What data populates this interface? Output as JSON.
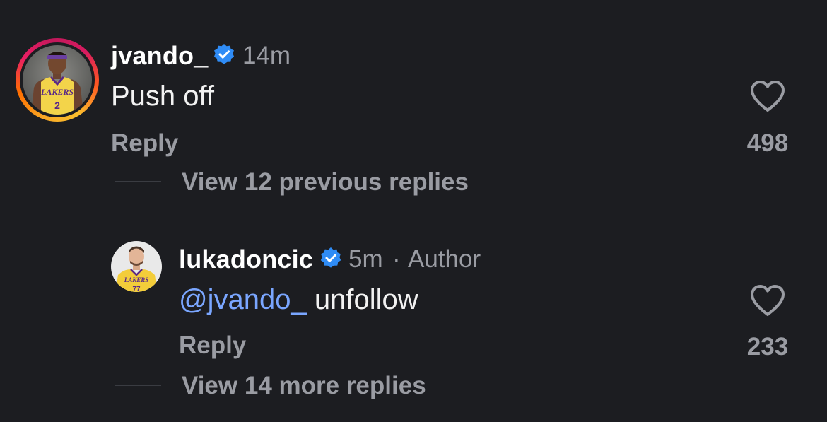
{
  "comments": [
    {
      "username": "jvando_",
      "verified": true,
      "time": "14m",
      "text": "Push off",
      "reply_label": "Reply",
      "likes": "498",
      "view_replies": "View 12 previous replies",
      "avatar": "player-lakers-jersey-2-avatar",
      "has_story_ring": true
    }
  ],
  "reply": {
    "username": "lukadoncic",
    "verified": true,
    "time": "5m",
    "separator": "·",
    "role": "Author",
    "mention": "@jvando_",
    "text": " unfollow",
    "reply_label": "Reply",
    "likes": "233",
    "view_replies": "View 14 more replies",
    "avatar": "player-lakers-jersey-77-avatar"
  },
  "colors": {
    "background": "#1c1d21",
    "verified_badge": "#2f8cf6",
    "mention": "#7aa6ff",
    "muted": "#9a9ca3"
  },
  "icons": {
    "verified": "verified-badge-icon",
    "like": "heart-outline-icon"
  }
}
